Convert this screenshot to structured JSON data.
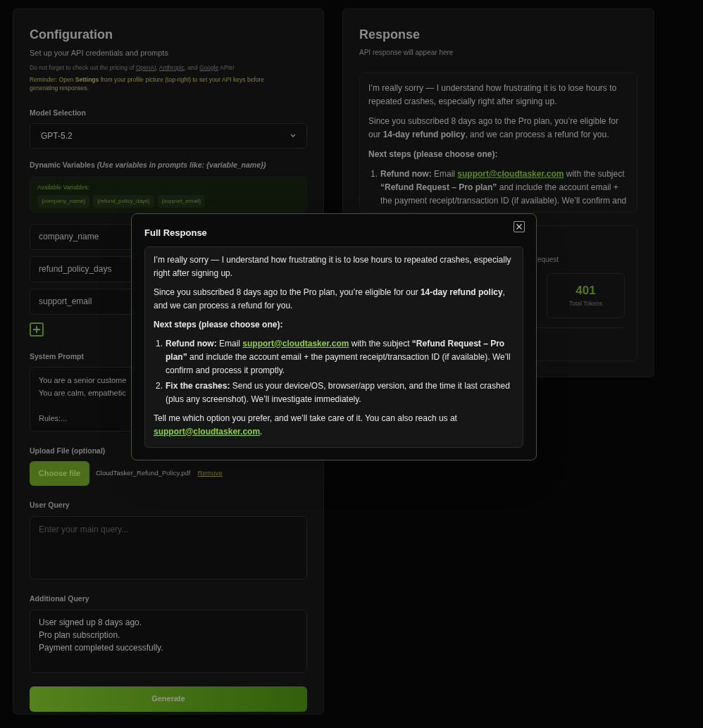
{
  "configuration": {
    "title": "Configuration",
    "subtitle": "Set up your API credentials and prompts",
    "pricing_note": [
      {
        "kind": "text",
        "text": "Do not forget to check out the pricing of "
      },
      {
        "kind": "link",
        "text": "OpenAI"
      },
      {
        "kind": "text",
        "text": ", "
      },
      {
        "kind": "link",
        "text": "Anthropic"
      },
      {
        "kind": "text",
        "text": ", and "
      },
      {
        "kind": "link",
        "text": "Google"
      },
      {
        "kind": "text",
        "text": " APIs!"
      }
    ],
    "reminder": "Reminder: Open **Settings** from your profile picture (top-right) to set your API keys before generating responses.",
    "model_selection": {
      "label": "Model Selection",
      "value": "GPT-5.2"
    },
    "dynamic_variables": {
      "label": "Dynamic Variables",
      "hint": "(Use variables in prompts like: {variable_name})",
      "available_label": "Available Variables:",
      "chips": [
        "{company_name}",
        "{refund_policy_days}",
        "{support_email}"
      ],
      "fields": [
        {
          "value": "company_name"
        },
        {
          "value": "refund_policy_days"
        },
        {
          "value": "support_email"
        }
      ]
    },
    "system_prompt": {
      "label": "System Prompt",
      "value": "You are a senior custome\nYou are calm, empathetic\n\nRules:..."
    },
    "upload": {
      "label": "Upload File (optional)",
      "button": "Choose file",
      "file_name": "CloudTasker_Refund_Policy.pdf",
      "remove": "Remove"
    },
    "user_query": {
      "label": "User Query",
      "placeholder": "Enter your main query..."
    },
    "additional_query": {
      "label": "Additional Query",
      "value": "User signed up 8 days ago.\nPro plan subscription.\nPayment completed successfully."
    },
    "generate_button": "Generate"
  },
  "response": {
    "title": "Response",
    "subtitle": "API response will appear here",
    "preview": [
      {
        "kind": "para",
        "parts": [
          {
            "kind": "text",
            "text": "I’m really sorry — I understand how frustrating it is to lose hours to repeated crashes, especially right after signing up."
          }
        ]
      },
      {
        "kind": "para",
        "parts": [
          {
            "kind": "text",
            "text": "Since you subscribed 8 days ago to the Pro plan, you’re eligible for our **14-day refund policy**, and we can process a refund for you."
          }
        ]
      },
      {
        "kind": "heading",
        "parts": [
          {
            "kind": "text",
            "text": "Next steps (please choose one):"
          }
        ]
      },
      {
        "kind": "list",
        "items": [
          {
            "number": "1.",
            "parts": [
              {
                "kind": "text",
                "text": "**Refund now:** Email "
              },
              {
                "kind": "link",
                "text": "support@cloudtasker.com"
              },
              {
                "kind": "text",
                "text": " with the subject **“Refund Request – Pro plan”** and include the account email + the payment receipt/transaction ID (if available). We’ll confirm and"
              }
            ]
          }
        ]
      }
    ],
    "stats": {
      "caption": "equest",
      "total_tokens": {
        "value": "401",
        "label": "Total Tokens"
      }
    }
  },
  "modal": {
    "title": "Full Response",
    "blocks": [
      {
        "kind": "para",
        "parts": [
          {
            "kind": "text",
            "text": "I’m really sorry — I understand how frustrating it is to lose hours to repeated crashes, especially right after signing up."
          }
        ]
      },
      {
        "kind": "para",
        "parts": [
          {
            "kind": "text",
            "text": "Since you subscribed 8 days ago to the Pro plan, you’re eligible for our **14-day refund policy**, and we can process a refund for you."
          }
        ]
      },
      {
        "kind": "heading",
        "parts": [
          {
            "kind": "text",
            "text": "Next steps (please choose one):"
          }
        ]
      },
      {
        "kind": "list",
        "items": [
          {
            "number": "1.",
            "parts": [
              {
                "kind": "text",
                "text": "**Refund now:** Email "
              },
              {
                "kind": "link",
                "text": "support@cloudtasker.com"
              },
              {
                "kind": "text",
                "text": " with the subject **“Refund Request – Pro plan”** and include the account email + the payment receipt/transaction ID (if available). We’ll confirm and process it promptly."
              }
            ]
          },
          {
            "number": "2.",
            "parts": [
              {
                "kind": "text",
                "text": "**Fix the crashes:** Send us your device/OS, browser/app version, and the time it last crashed (plus any screenshot). We’ll investigate immediately."
              }
            ]
          }
        ]
      },
      {
        "kind": "para",
        "parts": [
          {
            "kind": "text",
            "text": "Tell me which option you prefer, and we’ll take care of it. You can also reach us at "
          },
          {
            "kind": "link",
            "text": "support@cloudtasker.com"
          },
          {
            "kind": "text",
            "text": "."
          }
        ]
      }
    ]
  }
}
